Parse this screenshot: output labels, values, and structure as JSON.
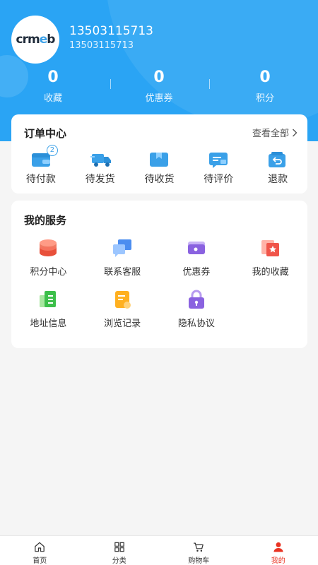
{
  "profile": {
    "avatar_text": "crmeb",
    "name": "13503115713",
    "phone": "13503115713"
  },
  "stats": [
    {
      "value": "0",
      "label": "收藏"
    },
    {
      "value": "0",
      "label": "优惠券"
    },
    {
      "value": "0",
      "label": "积分"
    }
  ],
  "orders": {
    "title": "订单中心",
    "view_all": "查看全部",
    "items": [
      {
        "label": "待付款",
        "icon": "wallet-icon",
        "badge": "2"
      },
      {
        "label": "待发货",
        "icon": "truck-icon"
      },
      {
        "label": "待收货",
        "icon": "box-icon"
      },
      {
        "label": "待评价",
        "icon": "comment-icon"
      },
      {
        "label": "退款",
        "icon": "refund-icon"
      }
    ]
  },
  "services": {
    "title": "我的服务",
    "items": [
      {
        "label": "积分中心",
        "icon": "coins-icon"
      },
      {
        "label": "联系客服",
        "icon": "chat-icon"
      },
      {
        "label": "优惠券",
        "icon": "ticket-icon"
      },
      {
        "label": "我的收藏",
        "icon": "favorite-icon"
      },
      {
        "label": "地址信息",
        "icon": "address-icon"
      },
      {
        "label": "浏览记录",
        "icon": "history-icon"
      },
      {
        "label": "隐私协议",
        "icon": "lock-icon"
      }
    ]
  },
  "tabbar": [
    {
      "label": "首页",
      "icon": "home-icon"
    },
    {
      "label": "分类",
      "icon": "grid-icon"
    },
    {
      "label": "购物车",
      "icon": "cart-icon"
    },
    {
      "label": "我的",
      "icon": "user-icon",
      "active": true
    }
  ],
  "colors": {
    "header_blue": "#2aa4f4",
    "accent_red": "#e93323",
    "icon_blue": "#3aa0e8"
  }
}
